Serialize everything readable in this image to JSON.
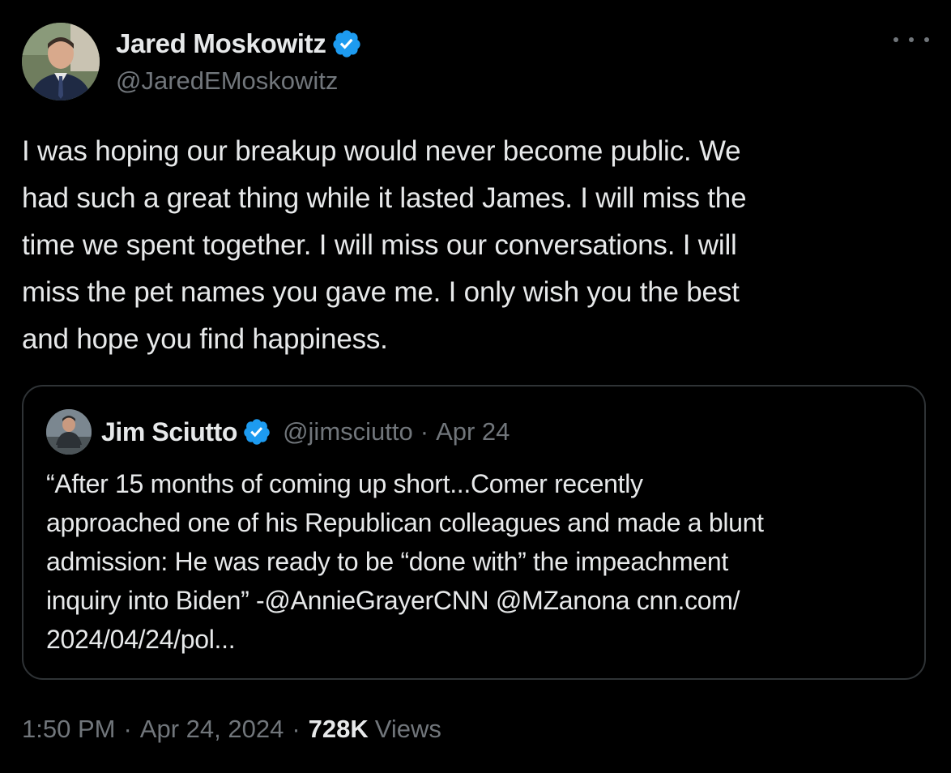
{
  "author": {
    "name": "Jared Moskowitz",
    "handle": "@JaredEMoskowitz",
    "verified_icon": "verified-badge-icon",
    "avatar_icon": "profile-photo"
  },
  "more_icon": "more-options-icon",
  "tweet": {
    "lines": [
      "I was hoping our breakup would never become public. We",
      "had such a great thing while it lasted James. I will miss the",
      "time we spent together. I will miss our conversations. I will",
      "miss the pet names you gave me. I only wish you the best",
      "and hope you find happiness."
    ]
  },
  "quoted_tweet": {
    "name": "Jim Sciutto",
    "handle": "@jimsciutto",
    "separator": "·",
    "date": "Apr 24",
    "lines": [
      "“After 15 months of coming up short...Comer recently",
      "approached one of his Republican colleagues and made a blunt",
      "admission: He was ready to be “done with” the impeachment",
      "inquiry into Biden” -@AnnieGrayerCNN @MZanona  cnn.com/",
      "2024/04/24/pol..."
    ]
  },
  "meta": {
    "time": "1:50 PM",
    "separator": "·",
    "date": "Apr 24, 2024",
    "views_count": "728K",
    "views_label": "Views"
  },
  "colors": {
    "background": "#000000",
    "text_primary": "#e7e9ea",
    "text_secondary": "#71767b",
    "border": "#2f3336",
    "verified_blue": "#1d9bf0"
  }
}
